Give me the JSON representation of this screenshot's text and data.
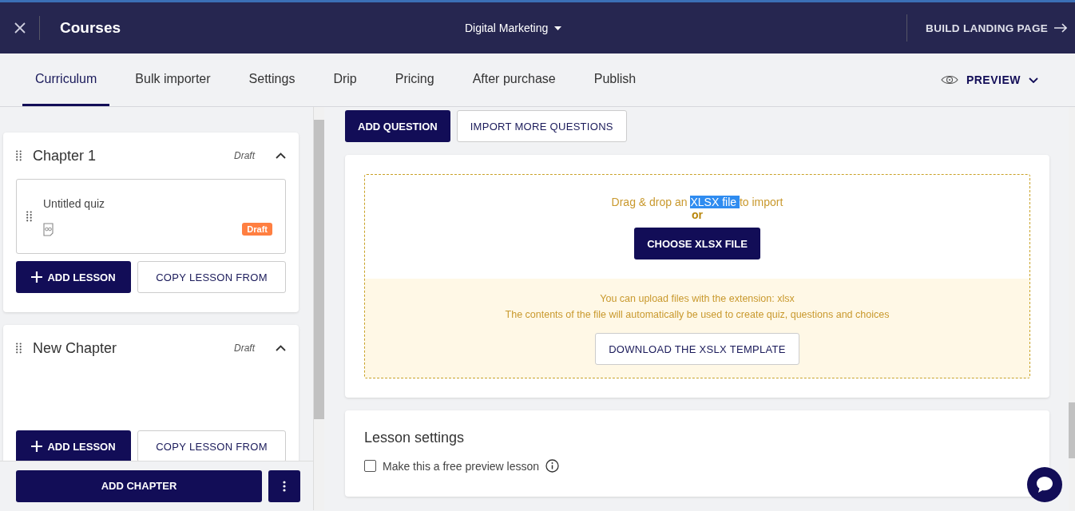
{
  "header": {
    "title": "Courses",
    "course_selector": "Digital Marketing",
    "action": "BUILD LANDING PAGE"
  },
  "tabs": [
    {
      "label": "Curriculum",
      "selected": true
    },
    {
      "label": "Bulk importer",
      "selected": false
    },
    {
      "label": "Settings",
      "selected": false
    },
    {
      "label": "Drip",
      "selected": false
    },
    {
      "label": "Pricing",
      "selected": false
    },
    {
      "label": "After purchase",
      "selected": false
    },
    {
      "label": "Publish",
      "selected": false
    }
  ],
  "preview": "PREVIEW",
  "chapters": [
    {
      "title": "Chapter 1",
      "status": "Draft",
      "expanded": true,
      "lessons": [
        {
          "title": "Untitled quiz",
          "badge": "Draft",
          "color": "#ff7f41"
        }
      ],
      "add_lesson": "ADD LESSON",
      "copy_lesson": "COPY LESSON FROM"
    },
    {
      "title": "New Chapter",
      "status": "Draft",
      "expanded": true,
      "add_lesson": "ADD LESSON",
      "copy_lesson": "COPY LESSON FROM"
    }
  ],
  "add_chapter": "ADD CHAPTER",
  "question_buttons": [
    {
      "label": "ADD QUESTION",
      "kind": "primary"
    },
    {
      "label": "IMPORT MORE QUESTIONS",
      "kind": "secondary"
    }
  ],
  "import": {
    "drop_before": "Drag & drop an ",
    "drop_selected": "XLSX file ",
    "drop_after": "to import",
    "or": "or",
    "choose": "CHOOSE XLSX FILE",
    "info": [
      "You can upload files with the extension: xlsx",
      "The contents of the file will automatically be used to create quiz, questions and choices"
    ],
    "template": "DOWNLOAD THE XSLX TEMPLATE"
  },
  "lesson_settings": {
    "title": "Lesson settings",
    "free_preview": {
      "label": "Make this a free preview lesson",
      "checked": false
    }
  }
}
